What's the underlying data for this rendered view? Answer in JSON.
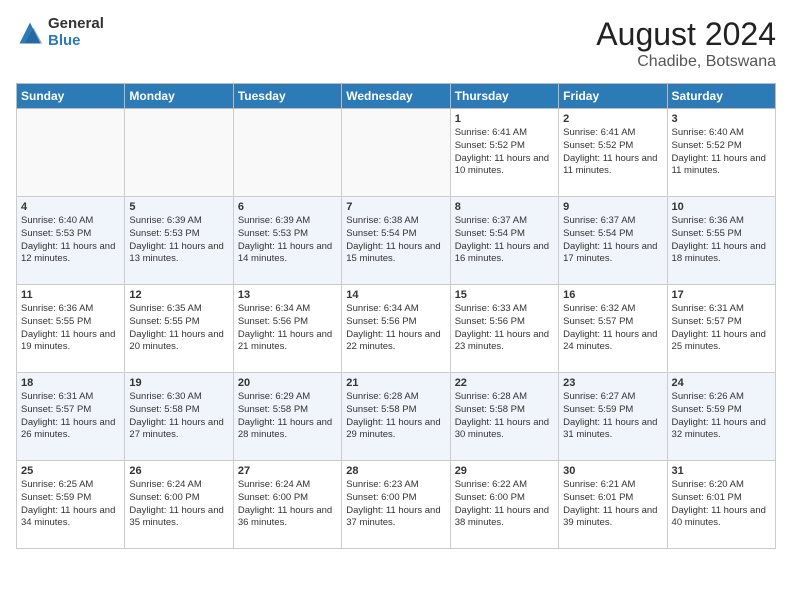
{
  "header": {
    "logo_general": "General",
    "logo_blue": "Blue",
    "month_year": "August 2024",
    "location": "Chadibe, Botswana"
  },
  "calendar": {
    "days_of_week": [
      "Sunday",
      "Monday",
      "Tuesday",
      "Wednesday",
      "Thursday",
      "Friday",
      "Saturday"
    ],
    "weeks": [
      [
        {
          "day": "",
          "content": ""
        },
        {
          "day": "",
          "content": ""
        },
        {
          "day": "",
          "content": ""
        },
        {
          "day": "",
          "content": ""
        },
        {
          "day": "1",
          "content": "Sunrise: 6:41 AM\nSunset: 5:52 PM\nDaylight: 11 hours and 10 minutes."
        },
        {
          "day": "2",
          "content": "Sunrise: 6:41 AM\nSunset: 5:52 PM\nDaylight: 11 hours and 11 minutes."
        },
        {
          "day": "3",
          "content": "Sunrise: 6:40 AM\nSunset: 5:52 PM\nDaylight: 11 hours and 11 minutes."
        }
      ],
      [
        {
          "day": "4",
          "content": "Sunrise: 6:40 AM\nSunset: 5:53 PM\nDaylight: 11 hours and 12 minutes."
        },
        {
          "day": "5",
          "content": "Sunrise: 6:39 AM\nSunset: 5:53 PM\nDaylight: 11 hours and 13 minutes."
        },
        {
          "day": "6",
          "content": "Sunrise: 6:39 AM\nSunset: 5:53 PM\nDaylight: 11 hours and 14 minutes."
        },
        {
          "day": "7",
          "content": "Sunrise: 6:38 AM\nSunset: 5:54 PM\nDaylight: 11 hours and 15 minutes."
        },
        {
          "day": "8",
          "content": "Sunrise: 6:37 AM\nSunset: 5:54 PM\nDaylight: 11 hours and 16 minutes."
        },
        {
          "day": "9",
          "content": "Sunrise: 6:37 AM\nSunset: 5:54 PM\nDaylight: 11 hours and 17 minutes."
        },
        {
          "day": "10",
          "content": "Sunrise: 6:36 AM\nSunset: 5:55 PM\nDaylight: 11 hours and 18 minutes."
        }
      ],
      [
        {
          "day": "11",
          "content": "Sunrise: 6:36 AM\nSunset: 5:55 PM\nDaylight: 11 hours and 19 minutes."
        },
        {
          "day": "12",
          "content": "Sunrise: 6:35 AM\nSunset: 5:55 PM\nDaylight: 11 hours and 20 minutes."
        },
        {
          "day": "13",
          "content": "Sunrise: 6:34 AM\nSunset: 5:56 PM\nDaylight: 11 hours and 21 minutes."
        },
        {
          "day": "14",
          "content": "Sunrise: 6:34 AM\nSunset: 5:56 PM\nDaylight: 11 hours and 22 minutes."
        },
        {
          "day": "15",
          "content": "Sunrise: 6:33 AM\nSunset: 5:56 PM\nDaylight: 11 hours and 23 minutes."
        },
        {
          "day": "16",
          "content": "Sunrise: 6:32 AM\nSunset: 5:57 PM\nDaylight: 11 hours and 24 minutes."
        },
        {
          "day": "17",
          "content": "Sunrise: 6:31 AM\nSunset: 5:57 PM\nDaylight: 11 hours and 25 minutes."
        }
      ],
      [
        {
          "day": "18",
          "content": "Sunrise: 6:31 AM\nSunset: 5:57 PM\nDaylight: 11 hours and 26 minutes."
        },
        {
          "day": "19",
          "content": "Sunrise: 6:30 AM\nSunset: 5:58 PM\nDaylight: 11 hours and 27 minutes."
        },
        {
          "day": "20",
          "content": "Sunrise: 6:29 AM\nSunset: 5:58 PM\nDaylight: 11 hours and 28 minutes."
        },
        {
          "day": "21",
          "content": "Sunrise: 6:28 AM\nSunset: 5:58 PM\nDaylight: 11 hours and 29 minutes."
        },
        {
          "day": "22",
          "content": "Sunrise: 6:28 AM\nSunset: 5:58 PM\nDaylight: 11 hours and 30 minutes."
        },
        {
          "day": "23",
          "content": "Sunrise: 6:27 AM\nSunset: 5:59 PM\nDaylight: 11 hours and 31 minutes."
        },
        {
          "day": "24",
          "content": "Sunrise: 6:26 AM\nSunset: 5:59 PM\nDaylight: 11 hours and 32 minutes."
        }
      ],
      [
        {
          "day": "25",
          "content": "Sunrise: 6:25 AM\nSunset: 5:59 PM\nDaylight: 11 hours and 34 minutes."
        },
        {
          "day": "26",
          "content": "Sunrise: 6:24 AM\nSunset: 6:00 PM\nDaylight: 11 hours and 35 minutes."
        },
        {
          "day": "27",
          "content": "Sunrise: 6:24 AM\nSunset: 6:00 PM\nDaylight: 11 hours and 36 minutes."
        },
        {
          "day": "28",
          "content": "Sunrise: 6:23 AM\nSunset: 6:00 PM\nDaylight: 11 hours and 37 minutes."
        },
        {
          "day": "29",
          "content": "Sunrise: 6:22 AM\nSunset: 6:00 PM\nDaylight: 11 hours and 38 minutes."
        },
        {
          "day": "30",
          "content": "Sunrise: 6:21 AM\nSunset: 6:01 PM\nDaylight: 11 hours and 39 minutes."
        },
        {
          "day": "31",
          "content": "Sunrise: 6:20 AM\nSunset: 6:01 PM\nDaylight: 11 hours and 40 minutes."
        }
      ]
    ]
  }
}
